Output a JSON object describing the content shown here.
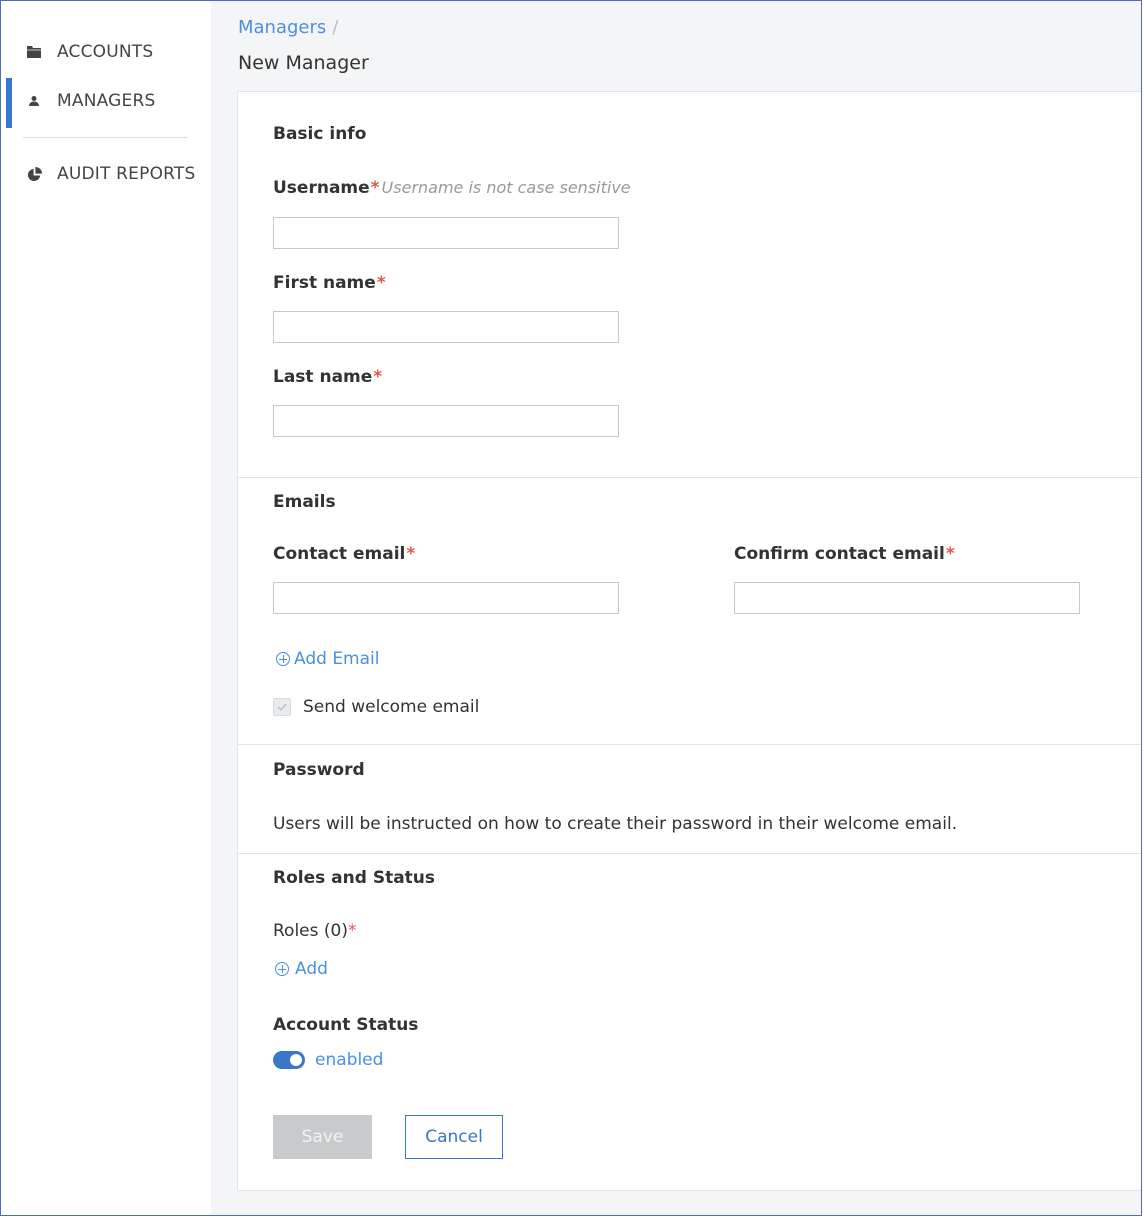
{
  "sidebar": {
    "items": [
      {
        "label": "ACCOUNTS",
        "icon": "folder-icon",
        "active": false
      },
      {
        "label": "MANAGERS",
        "icon": "person-icon",
        "active": true
      },
      {
        "label": "AUDIT REPORTS",
        "icon": "pie-chart-icon",
        "active": false
      }
    ]
  },
  "header": {
    "breadcrumb": "Managers",
    "breadcrumb_sep": "/",
    "title": "New Manager"
  },
  "form": {
    "basic_info": {
      "title": "Basic info",
      "username_label": "Username",
      "username_hint": "Username is not case sensitive",
      "username_value": "",
      "first_name_label": "First name",
      "first_name_value": "",
      "last_name_label": "Last name",
      "last_name_value": ""
    },
    "emails": {
      "title": "Emails",
      "contact_email_label": "Contact email",
      "contact_email_value": "",
      "confirm_email_label": "Confirm contact email",
      "confirm_email_value": "",
      "add_email_label": "Add Email",
      "send_welcome_label": "Send welcome email",
      "send_welcome_checked": true
    },
    "password": {
      "title": "Password",
      "description": "Users will be instructed on how to create their password in their welcome email."
    },
    "roles_status": {
      "title": "Roles and Status",
      "roles_label": "Roles (0)",
      "add_role_label": "Add",
      "account_status_label": "Account Status",
      "account_status_value": "enabled"
    },
    "required_marker": "*",
    "buttons": {
      "save_label": "Save",
      "cancel_label": "Cancel"
    }
  },
  "colors": {
    "accent": "#3a76c9",
    "link": "#4a90e2",
    "required": "#e0574f"
  }
}
